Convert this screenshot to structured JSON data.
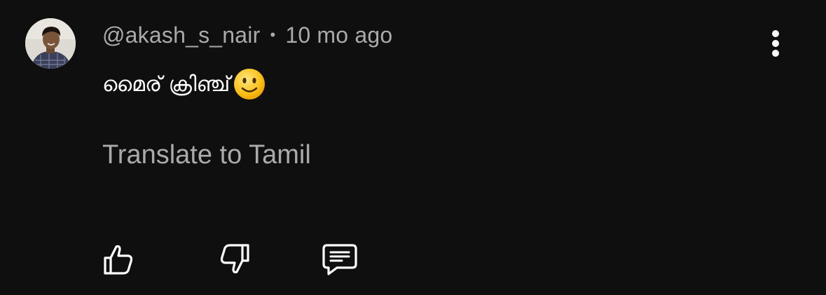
{
  "comment": {
    "author": "@akash_s_nair",
    "separator": "•",
    "time": "10 mo ago",
    "text": "മൈര് ക്രിഞ്ച്",
    "emoji": "slightly-smiling-face",
    "translate_label": "Translate to Tamil"
  },
  "icons": {
    "more": "vertical-ellipsis-icon",
    "like": "thumbs-up-icon",
    "dislike": "thumbs-down-icon",
    "reply": "comment-icon"
  },
  "colors": {
    "background": "#0f0f0f",
    "secondary_text": "#aaaaaa",
    "primary_text": "#ffffff"
  }
}
